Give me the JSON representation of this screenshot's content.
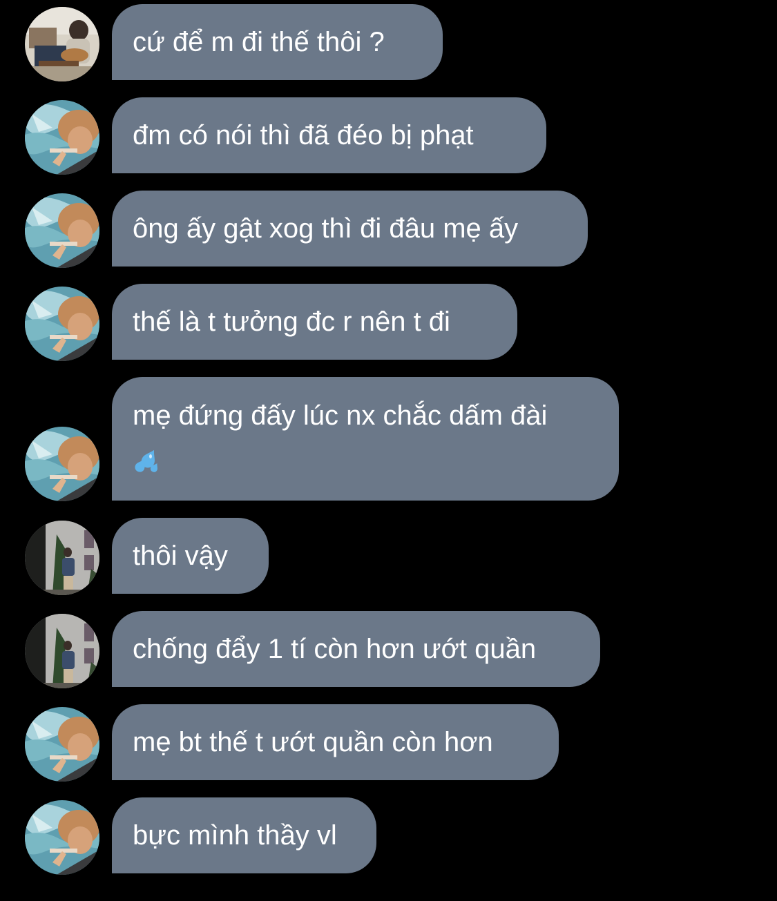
{
  "chat": {
    "messages": [
      {
        "text": "cứ để m đi thế thôi ?",
        "sender": "a"
      },
      {
        "text": "đm có nói thì đã đéo bị phạt",
        "sender": "b"
      },
      {
        "text": "ông ấy gật xog thì đi đâu mẹ ấy",
        "sender": "b"
      },
      {
        "text": "thế là t tưởng đc r nên t đi",
        "sender": "b"
      },
      {
        "text": "mẹ đứng đấy lúc nx chắc dấm đài",
        "emoji": "sweat-droplets-emoji",
        "sender": "b"
      },
      {
        "text": "thôi vậy",
        "sender": "c"
      },
      {
        "text": "chống đẩy 1 tí còn hơn ướt quần",
        "sender": "c"
      },
      {
        "text": "mẹ bt thế t ướt quần còn hơn",
        "sender": "b"
      },
      {
        "text": "bực mình thầy vl",
        "sender": "b"
      }
    ]
  },
  "colors": {
    "background": "#000000",
    "bubble": "#6b7889",
    "text": "#ffffff"
  }
}
